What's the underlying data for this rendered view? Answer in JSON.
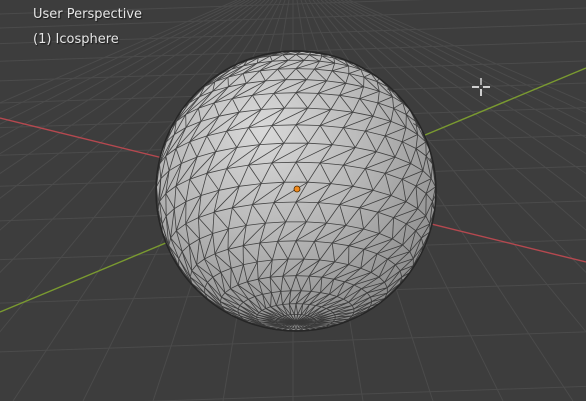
{
  "viewport": {
    "view_name": "User Perspective",
    "object_label": "(1) Icosphere"
  },
  "scene": {
    "object_type": "icosphere",
    "shading": "solid",
    "grid": true,
    "axes": [
      "x-axis-red",
      "y-axis-green"
    ],
    "origin_marker": true
  },
  "colors": {
    "background": "#3d3d3d",
    "grid": "#4a4a4a",
    "x_axis": "#b5484f",
    "y_axis": "#7a9a30",
    "mesh": "#b8b8b8",
    "edges": "#2a2a2a",
    "origin": "#f08a1e"
  },
  "cursor": {
    "icon": "crosshair-cursor-icon"
  }
}
